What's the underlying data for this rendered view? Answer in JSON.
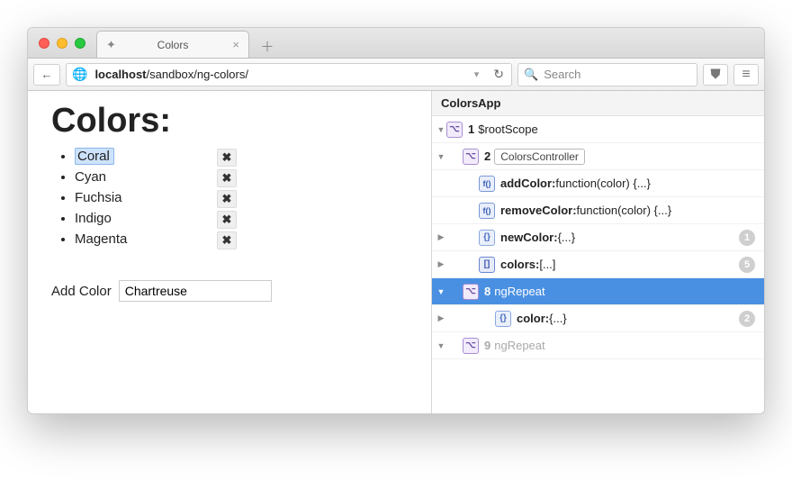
{
  "window": {
    "tab_title": "Colors",
    "url_host": "localhost",
    "url_path": "/sandbox/ng-colors/",
    "search_placeholder": "Search"
  },
  "page": {
    "heading": "Colors:",
    "colors": [
      {
        "name": "Coral",
        "selected": true
      },
      {
        "name": "Cyan",
        "selected": false
      },
      {
        "name": "Fuchsia",
        "selected": false
      },
      {
        "name": "Indigo",
        "selected": false
      },
      {
        "name": "Magenta",
        "selected": false
      }
    ],
    "add_label": "Add Color",
    "add_value": "Chartreuse"
  },
  "inspector": {
    "title": "ColorsApp",
    "nodes": [
      {
        "arrow": "down",
        "indent": 0,
        "icon": "scope",
        "number": "1",
        "text": "$rootScope",
        "pill": false
      },
      {
        "arrow": "down",
        "indent": 1,
        "icon": "scope",
        "number": "2",
        "text": "ColorsController",
        "pill": true
      },
      {
        "arrow": "",
        "indent": 2,
        "icon": "fn",
        "key": "addColor:",
        "val": " function(color) {...}"
      },
      {
        "arrow": "",
        "indent": 2,
        "icon": "fn",
        "key": "removeColor:",
        "val": " function(color) {...}"
      },
      {
        "arrow": "right",
        "indent": 2,
        "icon": "obj",
        "key": "newColor:",
        "val": " {...}",
        "badge": "1"
      },
      {
        "arrow": "right",
        "indent": 2,
        "icon": "arr",
        "key": "colors:",
        "val": " [...]",
        "badge": "5"
      },
      {
        "arrow": "down",
        "indent": 1,
        "icon": "scope",
        "number": "8",
        "text": "ngRepeat",
        "selected": true
      },
      {
        "arrow": "right",
        "indent": 3,
        "icon": "obj",
        "key": "color:",
        "val": " {...}",
        "badge": "2"
      },
      {
        "arrow": "down",
        "indent": 1,
        "icon": "scope",
        "number": "9",
        "text": "ngRepeat",
        "dim": true
      }
    ]
  }
}
